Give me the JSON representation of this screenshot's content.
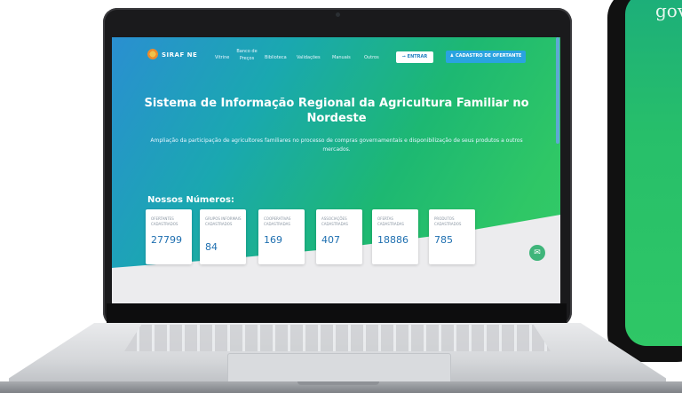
{
  "site": {
    "logo_text": "SIRAF NE",
    "nav": [
      "Vitrine",
      "Banco de Preços",
      "Biblioteca",
      "Validações",
      "Manuais",
      "Outros"
    ],
    "btn_entrar": "ENTRAR",
    "btn_cadastro": "CADASTRO DE OFERTANTE",
    "title": "Sistema de Informação Regional da Agricultura Familiar no Nordeste",
    "subtitle": "Ampliação da participação de agricultores familiares no processo de compras governamentais e disponibilização de seus produtos a outros mercados.",
    "stats_title": "Nossos Números:",
    "stats": [
      {
        "label": "OFERTANTES CADASTRADOS",
        "value": "27799"
      },
      {
        "label": "GRUPOS INFORMAIS CADASTRADOS",
        "value": "84"
      },
      {
        "label": "COOPERATIVAS CADASTRADAS",
        "value": "169"
      },
      {
        "label": "ASSOCIAÇÕES CADASTRADAS",
        "value": "407"
      },
      {
        "label": "OFERTAS CADASTRADAS",
        "value": "18886"
      },
      {
        "label": "PRODUTOS CADASTRADOS",
        "value": "785"
      }
    ]
  },
  "phone": {
    "text": "gov"
  },
  "colors": {
    "brand_blue": "#2aa3e0",
    "brand_green": "#2fc766",
    "value_blue": "#1e6fb0"
  },
  "icons": {
    "entrar": "login-icon",
    "cadastro": "user-add-icon",
    "chat": "chat-icon"
  }
}
